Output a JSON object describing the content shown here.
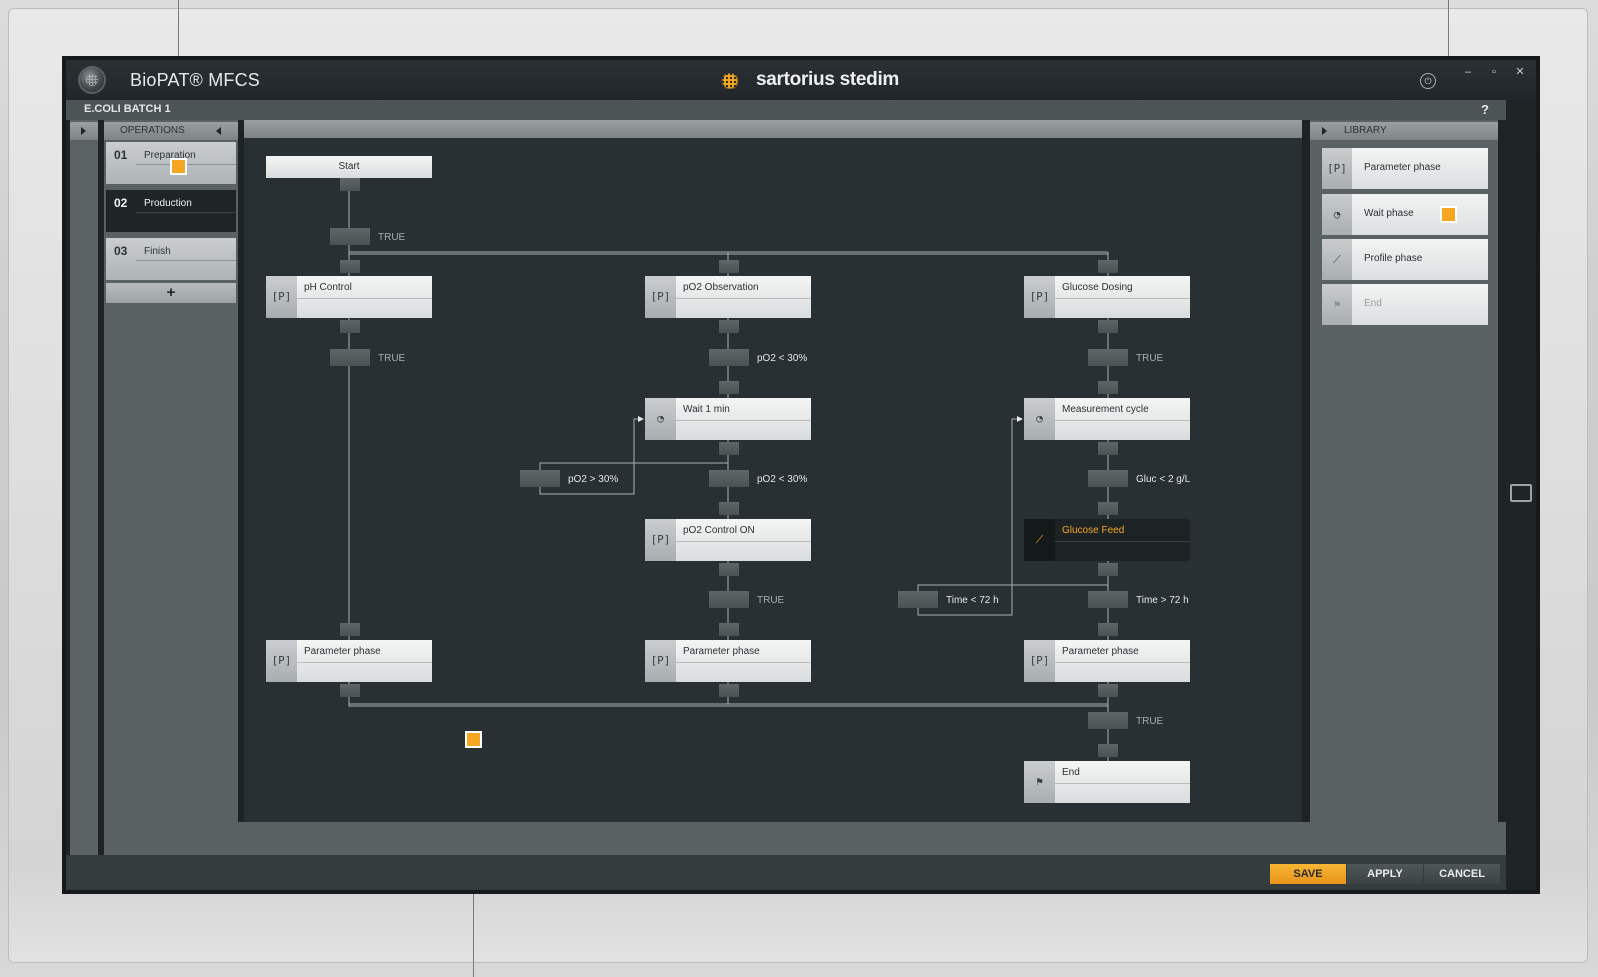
{
  "app": {
    "title": "BioPAT® MFCS",
    "brand": "sartorius stedim",
    "batch": "E.COLI BATCH 1",
    "help": "?"
  },
  "window_buttons": [
    "–",
    "▫",
    "✕"
  ],
  "operations": {
    "header": "OPERATIONS",
    "items": [
      {
        "num": "01",
        "label": "Preparation",
        "active": false
      },
      {
        "num": "02",
        "label": "Production",
        "active": true
      },
      {
        "num": "03",
        "label": "Finish",
        "active": false
      }
    ],
    "add_label": "+"
  },
  "library": {
    "header": "LIBRARY",
    "items": [
      {
        "icon": "[P]",
        "label": "Parameter phase",
        "enabled": true
      },
      {
        "icon": "◔",
        "label": "Wait phase",
        "enabled": true
      },
      {
        "icon": "⟋",
        "label": "Profile phase",
        "enabled": true
      },
      {
        "icon": "⚑",
        "label": "End",
        "enabled": false
      }
    ]
  },
  "diagram": {
    "start": "Start",
    "nodes": {
      "ph_control": {
        "icon": "[P]",
        "label": "pH Control"
      },
      "po2_observation": {
        "icon": "[P]",
        "label": "pO2 Observation"
      },
      "glucose_dosing": {
        "icon": "[P]",
        "label": "Glucose Dosing"
      },
      "wait_1_min": {
        "icon": "◔",
        "label": "Wait 1 min"
      },
      "measurement_cycle": {
        "icon": "◔",
        "label": "Measurement cycle"
      },
      "po2_control_on": {
        "icon": "[P]",
        "label": "pO2 Control ON"
      },
      "glucose_feed": {
        "icon": "⟋",
        "label": "Glucose Feed"
      },
      "param_phase_1": {
        "icon": "[P]",
        "label": "Parameter phase"
      },
      "param_phase_2": {
        "icon": "[P]",
        "label": "Parameter phase"
      },
      "param_phase_3": {
        "icon": "[P]",
        "label": "Parameter phase"
      },
      "end": {
        "icon": "⚑",
        "label": "End"
      }
    },
    "conditions": {
      "start_true": "TRUE",
      "ph_true": "TRUE",
      "po2_lt_30_a": "pO2 < 30%",
      "po2_gt_30": "pO2 > 30%",
      "po2_lt_30_b": "pO2 < 30%",
      "po2_control_true": "TRUE",
      "glucose_true": "TRUE",
      "gluc_lt_2": "Gluc < 2 g/L",
      "time_lt_72": "Time < 72 h",
      "time_gt_72": "Time > 72 h",
      "end_true": "TRUE"
    }
  },
  "footer": {
    "save": "SAVE",
    "apply": "APPLY",
    "cancel": "CANCEL"
  },
  "colors": {
    "accent": "#f5a623",
    "canvas": "#283033",
    "panel": "#5a6163"
  }
}
